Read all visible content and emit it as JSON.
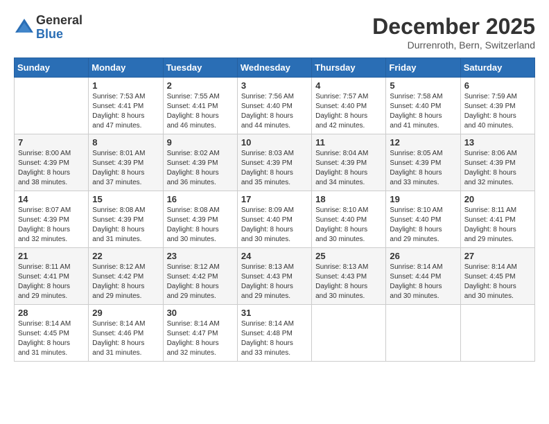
{
  "logo": {
    "general": "General",
    "blue": "Blue"
  },
  "title": {
    "month": "December 2025",
    "location": "Durrenroth, Bern, Switzerland"
  },
  "days_of_week": [
    "Sunday",
    "Monday",
    "Tuesday",
    "Wednesday",
    "Thursday",
    "Friday",
    "Saturday"
  ],
  "weeks": [
    [
      {
        "day": "",
        "info": ""
      },
      {
        "day": "1",
        "info": "Sunrise: 7:53 AM\nSunset: 4:41 PM\nDaylight: 8 hours\nand 47 minutes."
      },
      {
        "day": "2",
        "info": "Sunrise: 7:55 AM\nSunset: 4:41 PM\nDaylight: 8 hours\nand 46 minutes."
      },
      {
        "day": "3",
        "info": "Sunrise: 7:56 AM\nSunset: 4:40 PM\nDaylight: 8 hours\nand 44 minutes."
      },
      {
        "day": "4",
        "info": "Sunrise: 7:57 AM\nSunset: 4:40 PM\nDaylight: 8 hours\nand 42 minutes."
      },
      {
        "day": "5",
        "info": "Sunrise: 7:58 AM\nSunset: 4:40 PM\nDaylight: 8 hours\nand 41 minutes."
      },
      {
        "day": "6",
        "info": "Sunrise: 7:59 AM\nSunset: 4:39 PM\nDaylight: 8 hours\nand 40 minutes."
      }
    ],
    [
      {
        "day": "7",
        "info": "Sunrise: 8:00 AM\nSunset: 4:39 PM\nDaylight: 8 hours\nand 38 minutes."
      },
      {
        "day": "8",
        "info": "Sunrise: 8:01 AM\nSunset: 4:39 PM\nDaylight: 8 hours\nand 37 minutes."
      },
      {
        "day": "9",
        "info": "Sunrise: 8:02 AM\nSunset: 4:39 PM\nDaylight: 8 hours\nand 36 minutes."
      },
      {
        "day": "10",
        "info": "Sunrise: 8:03 AM\nSunset: 4:39 PM\nDaylight: 8 hours\nand 35 minutes."
      },
      {
        "day": "11",
        "info": "Sunrise: 8:04 AM\nSunset: 4:39 PM\nDaylight: 8 hours\nand 34 minutes."
      },
      {
        "day": "12",
        "info": "Sunrise: 8:05 AM\nSunset: 4:39 PM\nDaylight: 8 hours\nand 33 minutes."
      },
      {
        "day": "13",
        "info": "Sunrise: 8:06 AM\nSunset: 4:39 PM\nDaylight: 8 hours\nand 32 minutes."
      }
    ],
    [
      {
        "day": "14",
        "info": "Sunrise: 8:07 AM\nSunset: 4:39 PM\nDaylight: 8 hours\nand 32 minutes."
      },
      {
        "day": "15",
        "info": "Sunrise: 8:08 AM\nSunset: 4:39 PM\nDaylight: 8 hours\nand 31 minutes."
      },
      {
        "day": "16",
        "info": "Sunrise: 8:08 AM\nSunset: 4:39 PM\nDaylight: 8 hours\nand 30 minutes."
      },
      {
        "day": "17",
        "info": "Sunrise: 8:09 AM\nSunset: 4:40 PM\nDaylight: 8 hours\nand 30 minutes."
      },
      {
        "day": "18",
        "info": "Sunrise: 8:10 AM\nSunset: 4:40 PM\nDaylight: 8 hours\nand 30 minutes."
      },
      {
        "day": "19",
        "info": "Sunrise: 8:10 AM\nSunset: 4:40 PM\nDaylight: 8 hours\nand 29 minutes."
      },
      {
        "day": "20",
        "info": "Sunrise: 8:11 AM\nSunset: 4:41 PM\nDaylight: 8 hours\nand 29 minutes."
      }
    ],
    [
      {
        "day": "21",
        "info": "Sunrise: 8:11 AM\nSunset: 4:41 PM\nDaylight: 8 hours\nand 29 minutes."
      },
      {
        "day": "22",
        "info": "Sunrise: 8:12 AM\nSunset: 4:42 PM\nDaylight: 8 hours\nand 29 minutes."
      },
      {
        "day": "23",
        "info": "Sunrise: 8:12 AM\nSunset: 4:42 PM\nDaylight: 8 hours\nand 29 minutes."
      },
      {
        "day": "24",
        "info": "Sunrise: 8:13 AM\nSunset: 4:43 PM\nDaylight: 8 hours\nand 29 minutes."
      },
      {
        "day": "25",
        "info": "Sunrise: 8:13 AM\nSunset: 4:43 PM\nDaylight: 8 hours\nand 30 minutes."
      },
      {
        "day": "26",
        "info": "Sunrise: 8:14 AM\nSunset: 4:44 PM\nDaylight: 8 hours\nand 30 minutes."
      },
      {
        "day": "27",
        "info": "Sunrise: 8:14 AM\nSunset: 4:45 PM\nDaylight: 8 hours\nand 30 minutes."
      }
    ],
    [
      {
        "day": "28",
        "info": "Sunrise: 8:14 AM\nSunset: 4:45 PM\nDaylight: 8 hours\nand 31 minutes."
      },
      {
        "day": "29",
        "info": "Sunrise: 8:14 AM\nSunset: 4:46 PM\nDaylight: 8 hours\nand 31 minutes."
      },
      {
        "day": "30",
        "info": "Sunrise: 8:14 AM\nSunset: 4:47 PM\nDaylight: 8 hours\nand 32 minutes."
      },
      {
        "day": "31",
        "info": "Sunrise: 8:14 AM\nSunset: 4:48 PM\nDaylight: 8 hours\nand 33 minutes."
      },
      {
        "day": "",
        "info": ""
      },
      {
        "day": "",
        "info": ""
      },
      {
        "day": "",
        "info": ""
      }
    ]
  ]
}
